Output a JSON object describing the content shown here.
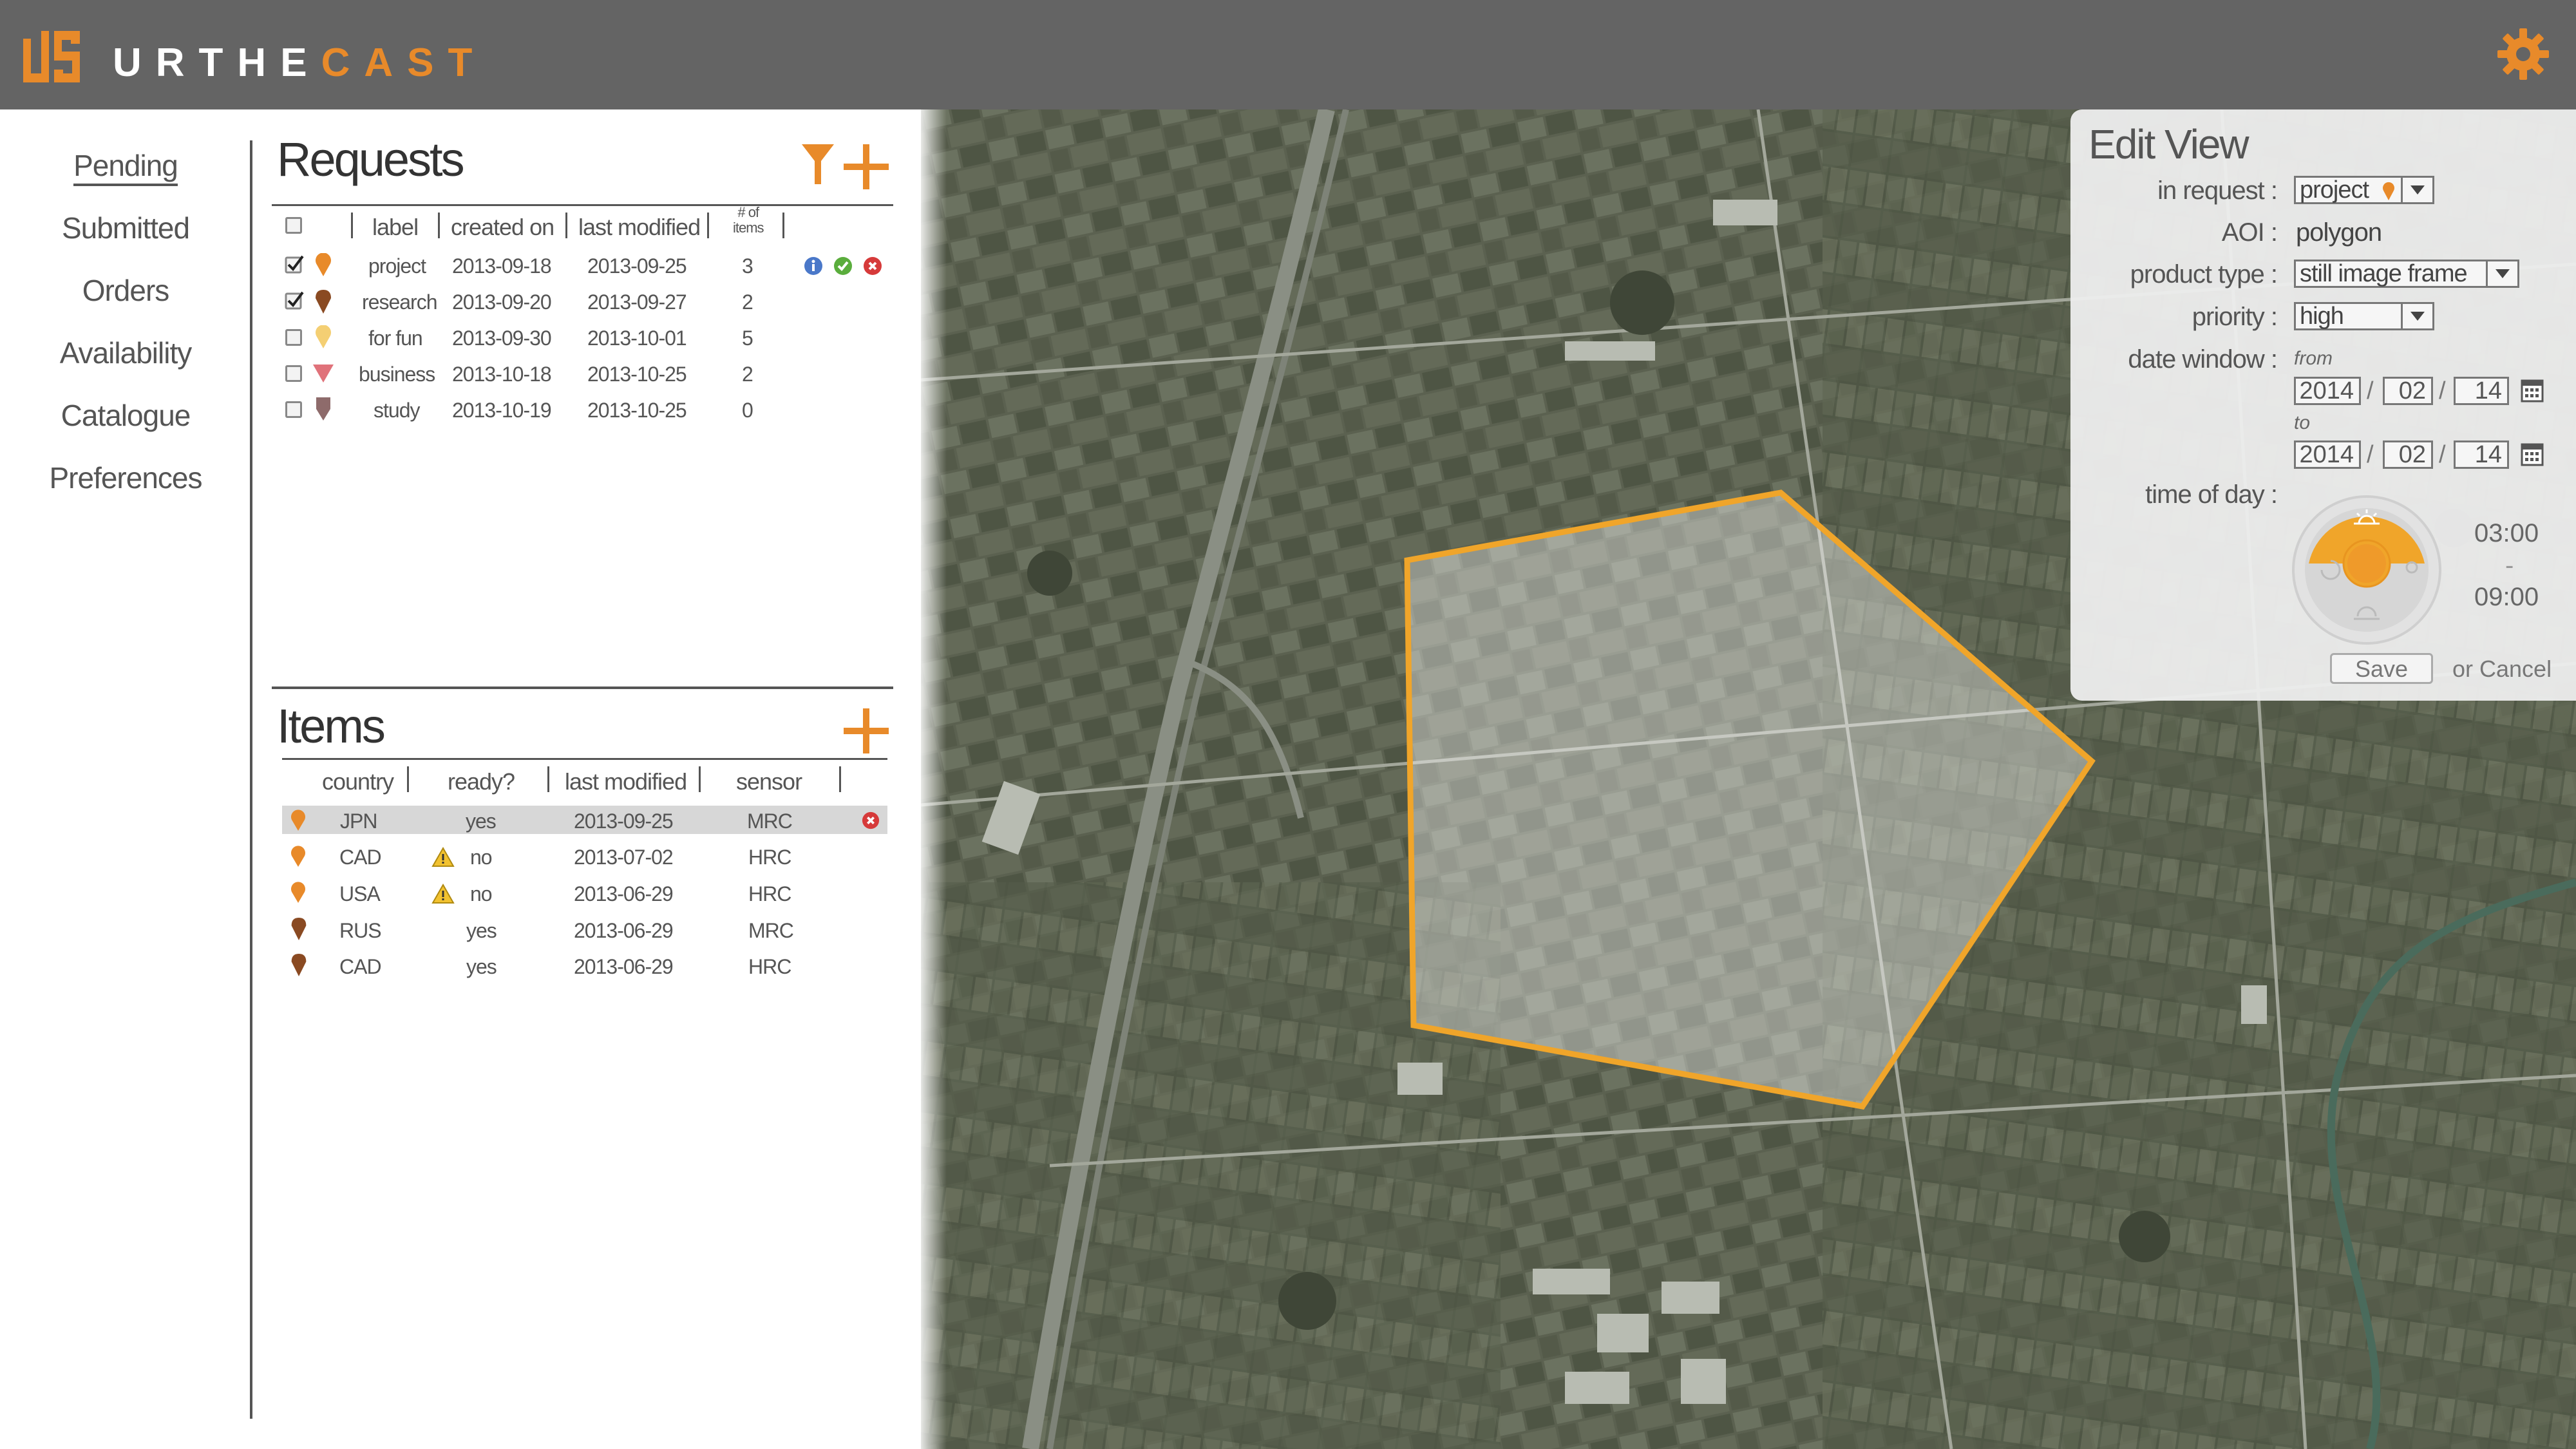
{
  "brand": {
    "name_part1": "URTHE",
    "name_part2": "CAST",
    "accent": "#e88a2a"
  },
  "header": {
    "settings_icon": "gear-icon"
  },
  "nav": {
    "items": [
      {
        "label": "Pending",
        "active": true
      },
      {
        "label": "Submitted"
      },
      {
        "label": "Orders"
      },
      {
        "label": "Availability"
      },
      {
        "label": "Catalogue"
      },
      {
        "label": "Preferences"
      }
    ]
  },
  "requests": {
    "title": "Requests",
    "columns": {
      "label": "label",
      "created": "created on",
      "modified": "last modified",
      "count_line1": "# of",
      "count_line2": "items"
    },
    "rows": [
      {
        "checked": true,
        "pin": "orange-pin-icon",
        "label": "project",
        "created": "2013-09-18",
        "modified": "2013-09-25",
        "count": "3"
      },
      {
        "checked": true,
        "pin": "brown-pin-icon",
        "label": "research",
        "created": "2013-09-20",
        "modified": "2013-09-27",
        "count": "2"
      },
      {
        "checked": false,
        "pin": "yellow-pin-icon",
        "label": "for fun",
        "created": "2013-09-30",
        "modified": "2013-10-01",
        "count": "5"
      },
      {
        "checked": false,
        "pin": "pink-triangle-icon",
        "label": "business",
        "created": "2013-10-18",
        "modified": "2013-10-25",
        "count": "2"
      },
      {
        "checked": false,
        "pin": "mauve-pin-icon",
        "label": "study",
        "created": "2013-10-19",
        "modified": "2013-10-25",
        "count": "0"
      }
    ],
    "row_actions": [
      "info-icon",
      "check-icon",
      "delete-icon"
    ]
  },
  "items": {
    "title": "Items",
    "columns": {
      "country": "country",
      "ready": "ready?",
      "modified": "last modified",
      "sensor": "sensor"
    },
    "rows": [
      {
        "country": "JPN",
        "warn": false,
        "ready": "yes",
        "modified": "2013-09-25",
        "sensor": "MRC",
        "selected": true
      },
      {
        "country": "CAD",
        "warn": true,
        "ready": "no",
        "modified": "2013-07-02",
        "sensor": "HRC"
      },
      {
        "country": "USA",
        "warn": true,
        "ready": "no",
        "modified": "2013-06-29",
        "sensor": "HRC"
      },
      {
        "country": "RUS",
        "warn": false,
        "ready": "yes",
        "modified": "2013-06-29",
        "sensor": "MRC"
      },
      {
        "country": "CAD",
        "warn": false,
        "ready": "yes",
        "modified": "2013-06-29",
        "sensor": "HRC"
      }
    ]
  },
  "edit_view": {
    "title": "Edit View",
    "in_request_label": "in request :",
    "in_request_value": "project",
    "aoi_label": "AOI :",
    "aoi_value": "polygon",
    "product_type_label": "product type :",
    "product_type_value": "still image frame",
    "priority_label": "priority :",
    "priority_value": "high",
    "date_window_label": "date window :",
    "from_label": "from",
    "to_label": "to",
    "from": {
      "year": "2014",
      "month": "02",
      "day": "14"
    },
    "to": {
      "year": "2014",
      "month": "02",
      "day": "14"
    },
    "time_of_day_label": "time of day :",
    "time_start": "03:00",
    "time_sep": "-",
    "time_end": "09:00",
    "save_label": "Save",
    "cancel_label": "or Cancel"
  }
}
